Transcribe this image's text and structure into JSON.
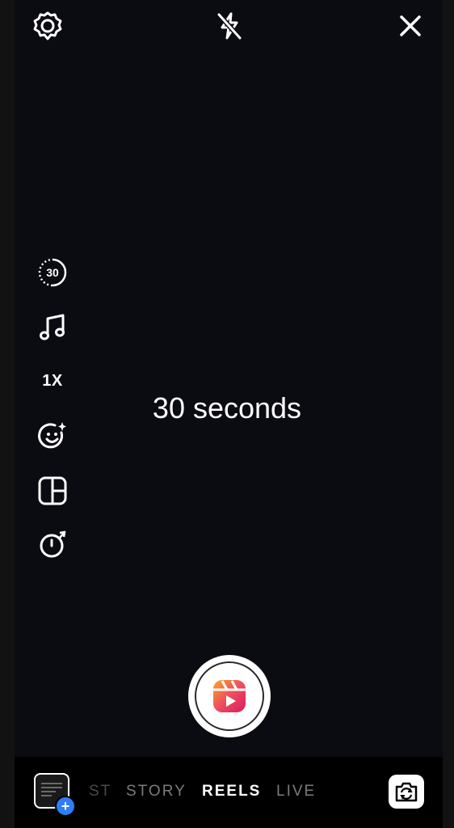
{
  "top_bar": {
    "settings_icon": "gear-icon",
    "flash_icon": "flash-off-icon",
    "close_icon": "close-icon"
  },
  "side_tools": {
    "length_badge": "30",
    "audio_icon": "music-note-icon",
    "speed_label": "1X",
    "effects_icon": "face-sparkle-icon",
    "layout_icon": "layout-grid-icon",
    "timer_icon": "timer-icon"
  },
  "center_label": "30 seconds",
  "modes": {
    "post_partial": "ST",
    "story": "STORY",
    "reels": "REELS",
    "live": "LIVE"
  },
  "gallery": {
    "add_symbol": "+"
  },
  "colors": {
    "accent_blue": "#2d7ff9",
    "reels_gradient_start": "#f9a825",
    "reels_gradient_end": "#d81b60"
  }
}
